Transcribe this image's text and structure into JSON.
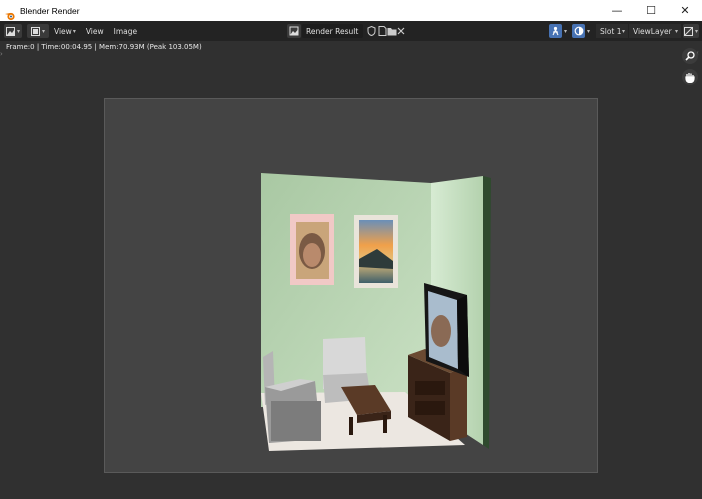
{
  "window": {
    "title": "Blender Render",
    "controls": [
      "—",
      "☐",
      "✕"
    ]
  },
  "header": {
    "view_menu_label": "View",
    "menus": [
      "View",
      "Image"
    ],
    "image_name": "Render Result",
    "slot": "Slot 1",
    "view_layer": "ViewLayer",
    "accent_color": "#4772b3"
  },
  "info": {
    "text": "Frame:0 | Time:00:04.95 | Mem:70.93M (Peak 103.05M)"
  },
  "icons": {
    "editor_type": "image-editor-icon",
    "view": "view-mode-icon",
    "image_browse": "image-browse-icon",
    "fake_user": "shield-icon",
    "new_image": "new-image-icon",
    "open_image": "folder-icon",
    "unlink": "close-icon",
    "sample_tool": "sample-tool-icon",
    "display_channels": "display-channels-icon",
    "zoom": "zoom-icon",
    "pan": "hand-icon"
  }
}
